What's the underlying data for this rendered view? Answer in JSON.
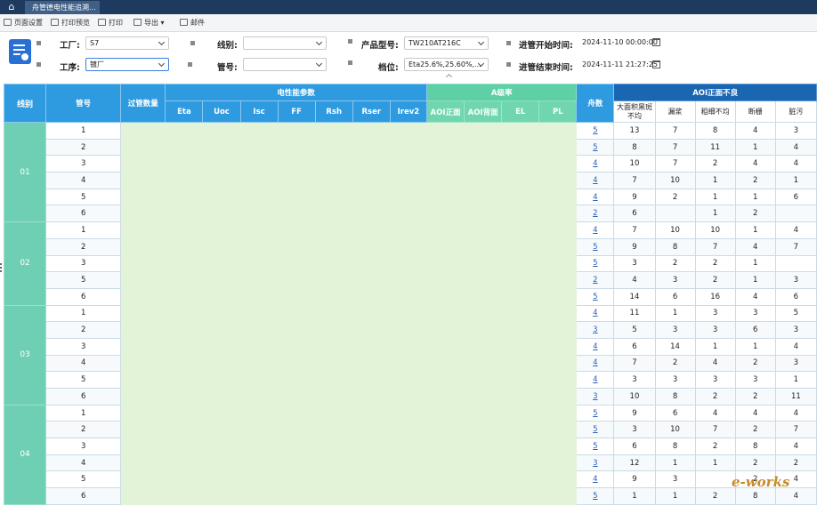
{
  "titlebar": {
    "tab_label": "舟管德电性能追溯..."
  },
  "toolbar": {
    "page_setup": "页面设置",
    "print_preview": "打印预览",
    "print": "打印",
    "export": "导出",
    "mail": "邮件"
  },
  "filters": {
    "factory_label": "工厂:",
    "factory_value": "S7",
    "process_label": "工序:",
    "process_value": "镀厂",
    "line_label": "线别:",
    "line_value": "",
    "tube_label": "管号:",
    "tube_value": "",
    "model_label": "产品型号:",
    "model_value": "TW210AT216C",
    "grade_label": "档位:",
    "grade_value": "Eta25.6%,25.60%,...",
    "start_label": "进管开始时间:",
    "start_value": "2024-11-10 00:00:00",
    "end_label": "进管结束时间:",
    "end_value": "2024-11-11 21:27:25"
  },
  "table": {
    "headers": {
      "line": "线别",
      "tube": "管号",
      "pass_count": "过管数量",
      "electrical_group": "电性能参数",
      "a_rate_group": "A级率",
      "boat_count": "舟数",
      "aoi_group": "AOI正面不良",
      "electrical": [
        "Eta",
        "Uoc",
        "Isc",
        "FF",
        "Rsh",
        "Rser",
        "Irev2"
      ],
      "a_rate": [
        "AOI正面",
        "AOI背面",
        "EL",
        "PL"
      ],
      "aoi": [
        "大面积黑斑不均",
        "漏浆",
        "粗细不均",
        "断栅",
        "脏污"
      ]
    },
    "groups": [
      {
        "line": "01",
        "rows": [
          {
            "tube": "1",
            "boat": "5",
            "aoi": [
              "13",
              "7",
              "8",
              "4",
              "3"
            ]
          },
          {
            "tube": "2",
            "boat": "5",
            "aoi": [
              "8",
              "7",
              "11",
              "1",
              "4"
            ]
          },
          {
            "tube": "3",
            "boat": "4",
            "aoi": [
              "10",
              "7",
              "2",
              "4",
              "4"
            ]
          },
          {
            "tube": "4",
            "boat": "4",
            "aoi": [
              "7",
              "10",
              "1",
              "2",
              "1"
            ]
          },
          {
            "tube": "5",
            "boat": "4",
            "aoi": [
              "9",
              "2",
              "1",
              "1",
              "6"
            ]
          },
          {
            "tube": "6",
            "boat": "2",
            "aoi": [
              "6",
              "",
              "1",
              "2",
              ""
            ]
          }
        ]
      },
      {
        "line": "02",
        "rows": [
          {
            "tube": "1",
            "boat": "4",
            "aoi": [
              "7",
              "10",
              "10",
              "1",
              "4"
            ]
          },
          {
            "tube": "2",
            "boat": "5",
            "aoi": [
              "9",
              "8",
              "7",
              "4",
              "7"
            ]
          },
          {
            "tube": "3",
            "boat": "5",
            "aoi": [
              "3",
              "2",
              "2",
              "1",
              ""
            ]
          },
          {
            "tube": "5",
            "boat": "2",
            "aoi": [
              "4",
              "3",
              "2",
              "1",
              "3"
            ]
          },
          {
            "tube": "6",
            "boat": "5",
            "aoi": [
              "14",
              "6",
              "16",
              "4",
              "6"
            ]
          }
        ]
      },
      {
        "line": "03",
        "rows": [
          {
            "tube": "1",
            "boat": "4",
            "aoi": [
              "11",
              "1",
              "3",
              "3",
              "5"
            ]
          },
          {
            "tube": "2",
            "boat": "3",
            "aoi": [
              "5",
              "3",
              "3",
              "6",
              "3"
            ]
          },
          {
            "tube": "3",
            "boat": "4",
            "aoi": [
              "6",
              "14",
              "1",
              "1",
              "4"
            ]
          },
          {
            "tube": "4",
            "boat": "4",
            "aoi": [
              "7",
              "2",
              "4",
              "2",
              "3"
            ]
          },
          {
            "tube": "5",
            "boat": "4",
            "aoi": [
              "3",
              "3",
              "3",
              "3",
              "1"
            ]
          },
          {
            "tube": "6",
            "boat": "3",
            "aoi": [
              "10",
              "8",
              "2",
              "2",
              "11"
            ]
          }
        ]
      },
      {
        "line": "04",
        "rows": [
          {
            "tube": "1",
            "boat": "5",
            "aoi": [
              "9",
              "6",
              "4",
              "4",
              "4"
            ]
          },
          {
            "tube": "2",
            "boat": "5",
            "aoi": [
              "3",
              "10",
              "7",
              "2",
              "7"
            ]
          },
          {
            "tube": "3",
            "boat": "5",
            "aoi": [
              "6",
              "8",
              "2",
              "8",
              "4"
            ]
          },
          {
            "tube": "4",
            "boat": "3",
            "aoi": [
              "12",
              "1",
              "1",
              "2",
              "2"
            ]
          },
          {
            "tube": "5",
            "boat": "4",
            "aoi": [
              "9",
              "3",
              "",
              "2",
              "4"
            ]
          },
          {
            "tube": "6",
            "boat": "5",
            "aoi": [
              "1",
              "1",
              "2",
              "8",
              "4"
            ]
          }
        ]
      }
    ]
  },
  "watermark": "e-works",
  "colors": {
    "header_blue": "#2e9be0",
    "header_green": "#5fcfa6",
    "header_dark": "#1a66b3",
    "line_cell": "#6fcfb4",
    "blurred_area": "#e3f3d8"
  }
}
